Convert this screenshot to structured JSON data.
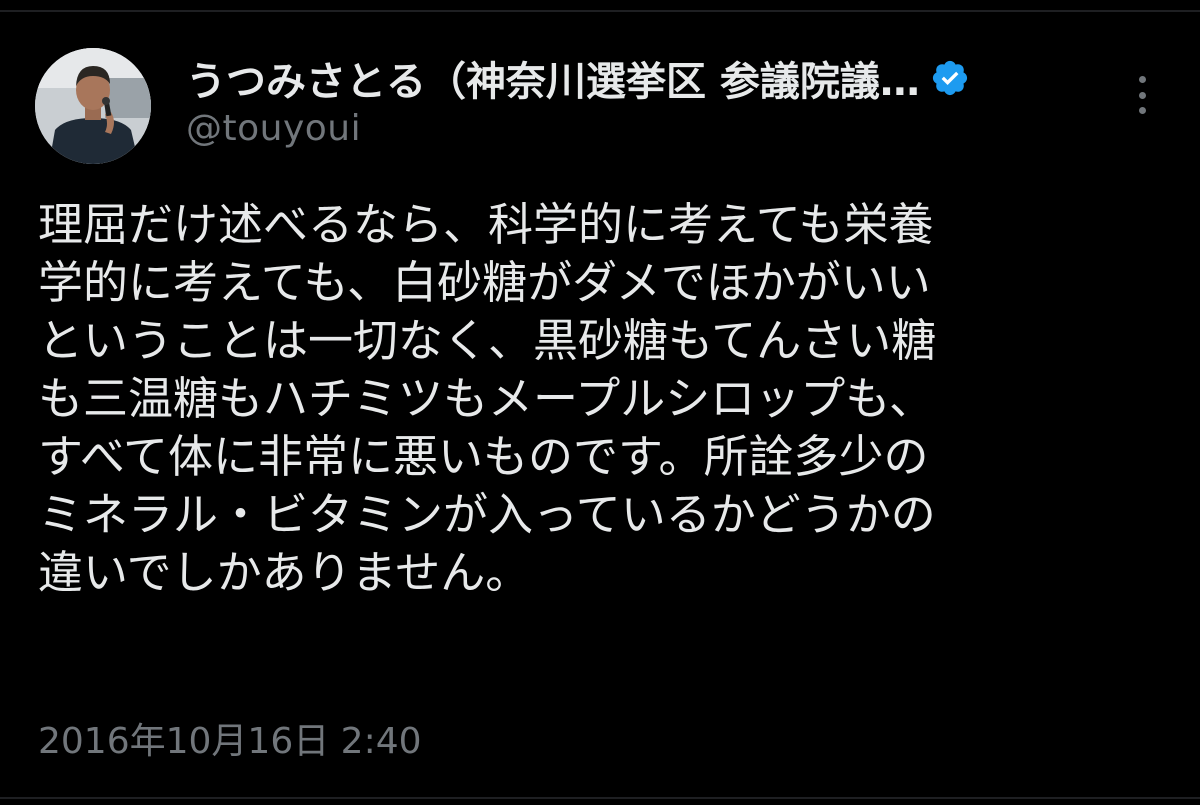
{
  "author": {
    "display_name": "うつみさとる（神奈川選挙区 参議院議…",
    "handle": "@touyoui",
    "avatar_icon": "person-speaking-photo",
    "verified_icon": "verified-badge-icon",
    "verified_color": "#1d9bf0"
  },
  "more_icon": "more-vertical-icon",
  "tweet": {
    "lines": [
      "理屈だけ述べるなら、科学的に考えても栄養",
      "学的に考えても、白砂糖がダメでほかがいい",
      "ということは一切なく、黒砂糖もてんさい糖",
      "も三温糖もハチミツもメープルシロップも、",
      "すべて体に非常に悪いものです。所詮多少の",
      "ミネラル・ビタミンが入っているかどうかの",
      "違いでしかありません。"
    ],
    "timestamp": "2016年10月16日 2:40"
  },
  "colors": {
    "background": "#000000",
    "text": "#e7e9ea",
    "secondary_text": "#71767b",
    "accent": "#1d9bf0"
  }
}
